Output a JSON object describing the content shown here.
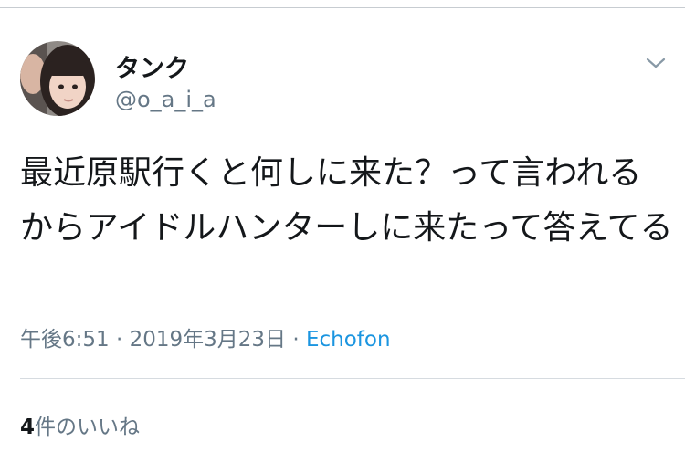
{
  "tweet": {
    "author": {
      "name": "タンク",
      "handle": "@o_a_i_a"
    },
    "text": "最近原駅行くと何しに来た？って言われるからアイドルハンターしに来たって答えてる",
    "time": "午後6:51",
    "separator": "·",
    "date": "2019年3月23日",
    "source": "Echofon",
    "likes": {
      "count": "4",
      "label": "件のいいね"
    }
  },
  "colors": {
    "text_primary": "#14171a",
    "text_secondary": "#657786",
    "link": "#1b95e0",
    "divider": "#d6dbe0"
  },
  "icons": {
    "caret": "chevron-down-icon"
  }
}
